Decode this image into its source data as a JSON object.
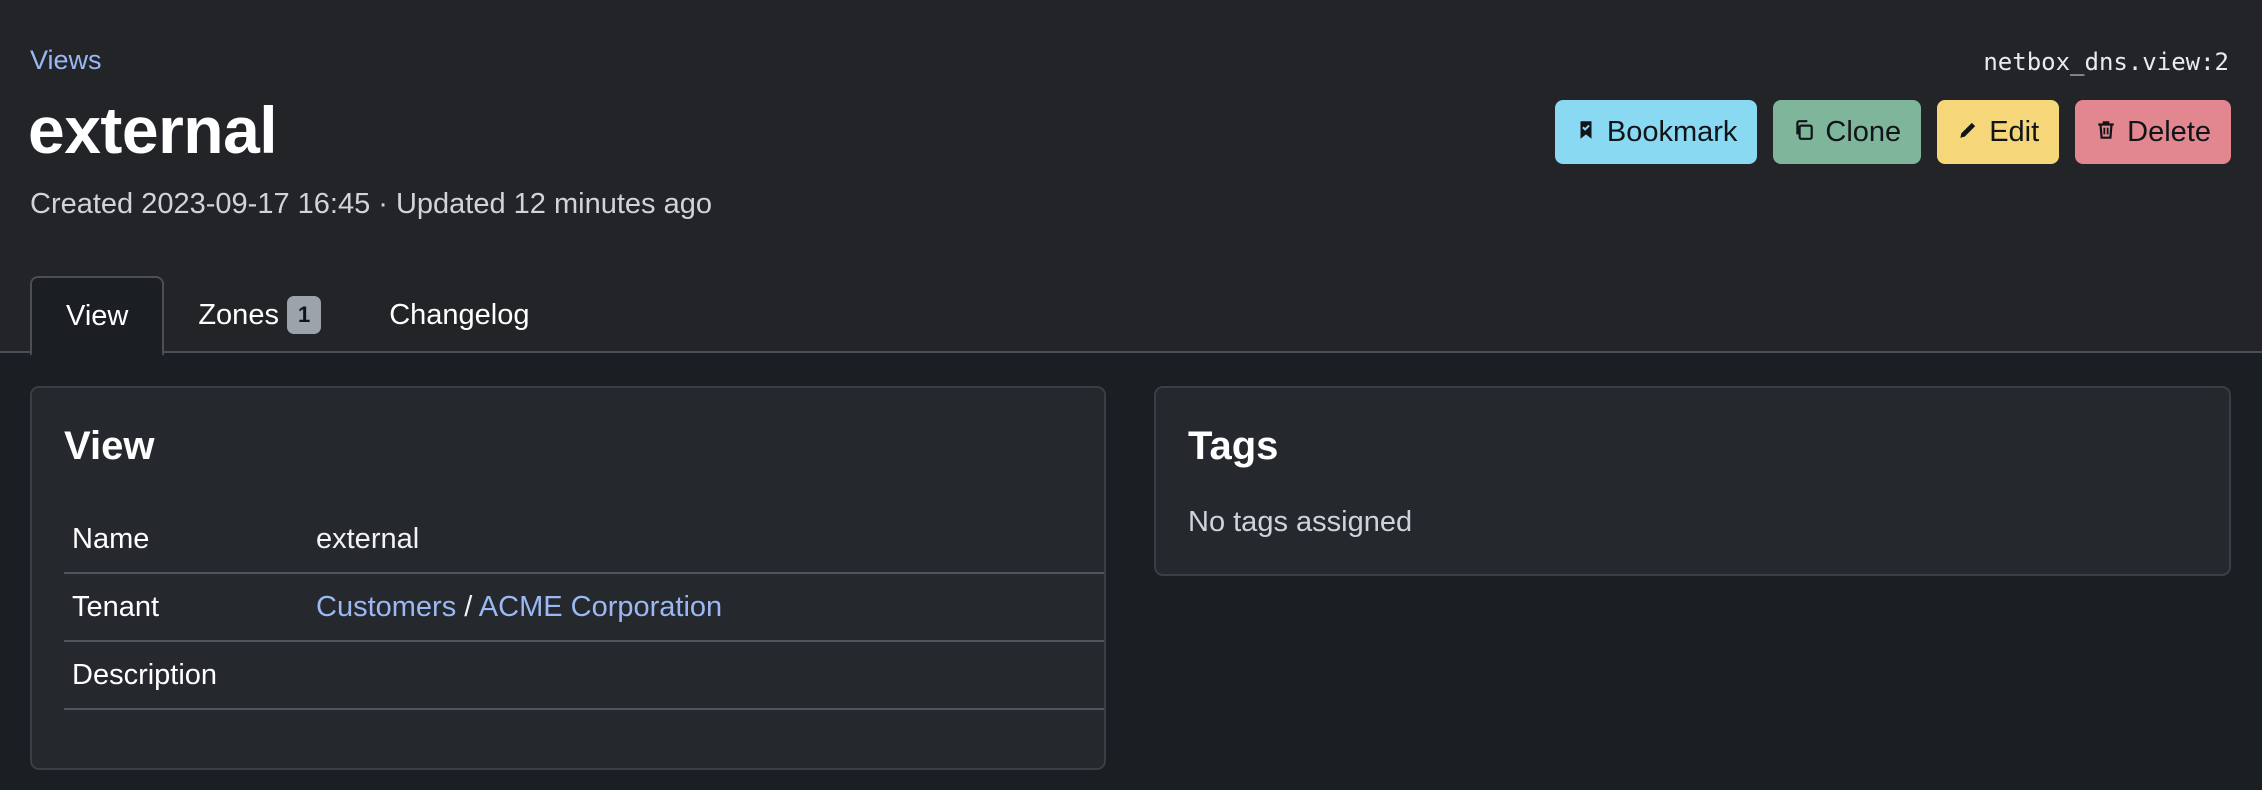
{
  "breadcrumb": {
    "label": "Views"
  },
  "object_id": "netbox_dns.view:2",
  "title": "external",
  "timestamps": "Created 2023-09-17 16:45 · Updated 12 minutes ago",
  "actions": {
    "bookmark": "Bookmark",
    "clone": "Clone",
    "edit": "Edit",
    "delete": "Delete"
  },
  "tabs": [
    {
      "label": "View",
      "active": true
    },
    {
      "label": "Zones",
      "badge": "1"
    },
    {
      "label": "Changelog"
    }
  ],
  "view_card": {
    "title": "View",
    "rows": [
      {
        "label": "Name",
        "value": "external"
      },
      {
        "label": "Tenant",
        "group": "Customers",
        "separator": "/",
        "tenant": "ACME Corporation"
      },
      {
        "label": "Description",
        "value": ""
      }
    ]
  },
  "tags_card": {
    "title": "Tags",
    "empty_text": "No tags assigned"
  },
  "colors": {
    "background": "#1b1e22",
    "header": "#222428",
    "card": "#25282c",
    "link": "#9bb8f4",
    "bookmark": "#8ad9f2",
    "clone": "#7fb69b",
    "edit": "#f5d77a",
    "delete": "#e2878f"
  }
}
